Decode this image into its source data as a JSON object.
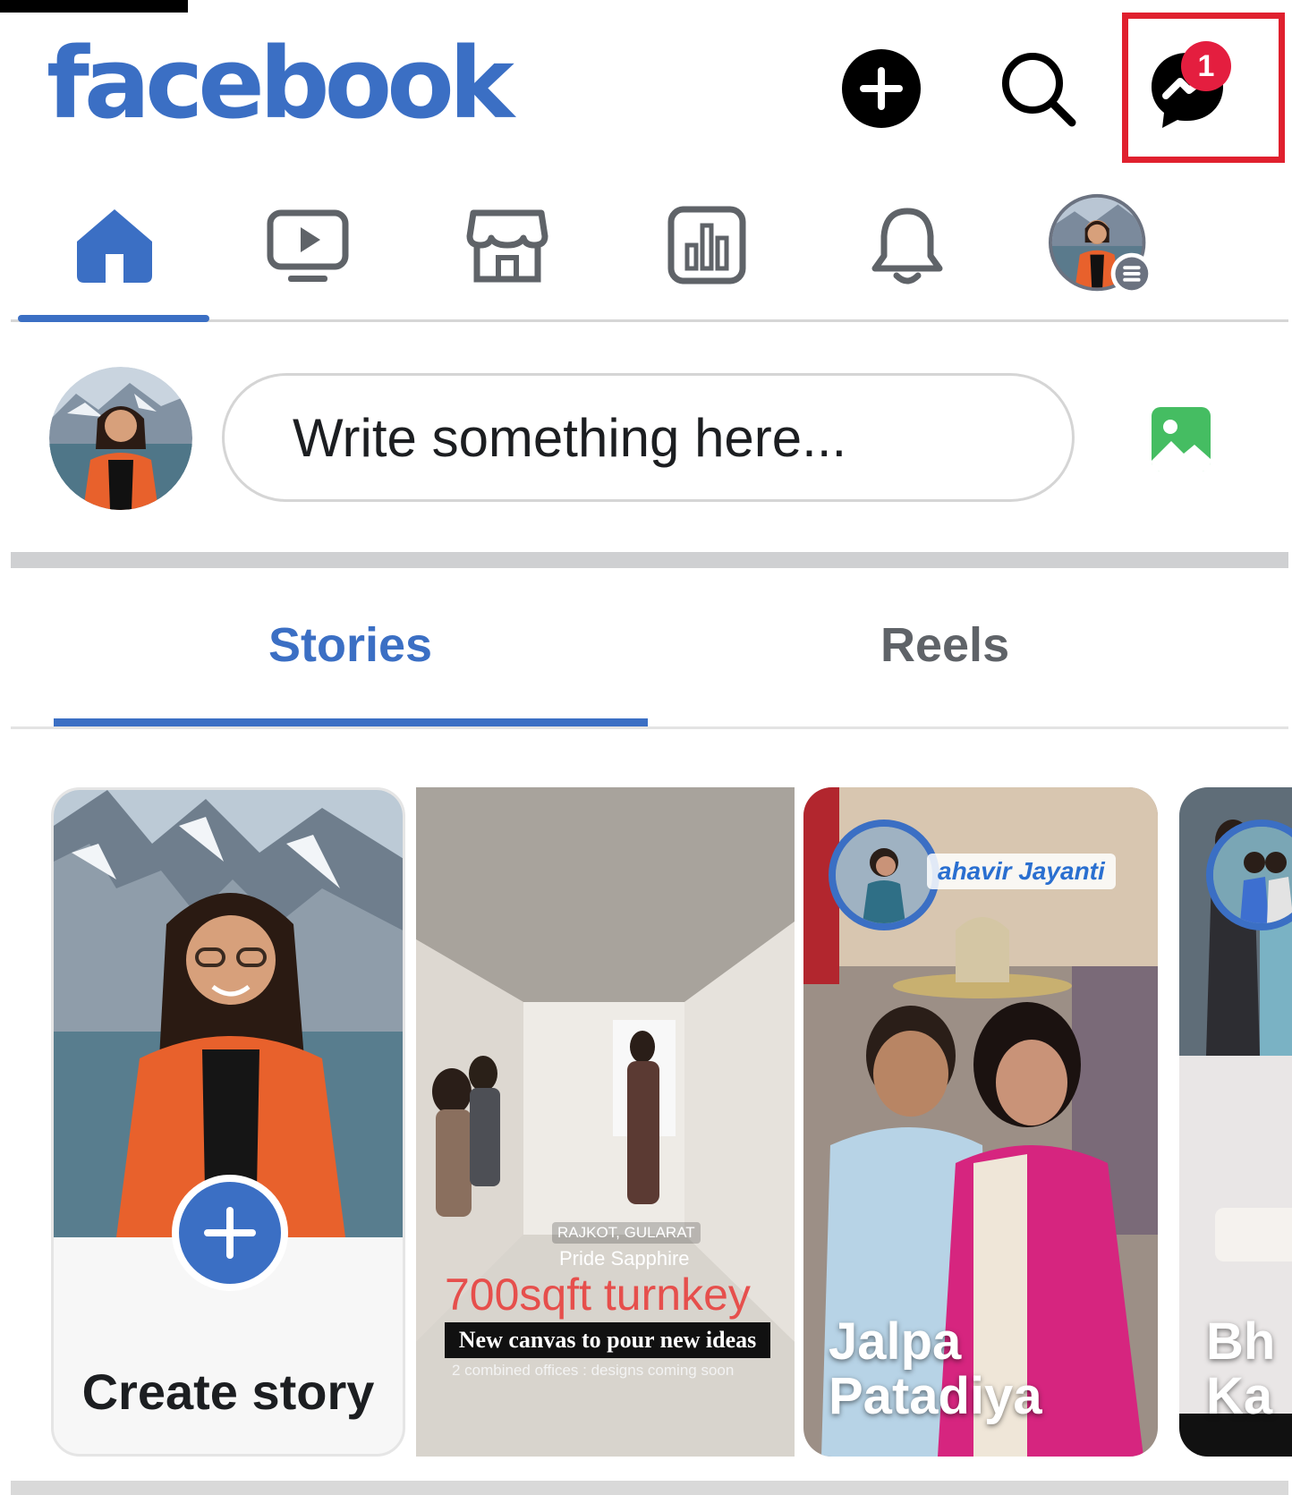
{
  "header": {
    "logo": "facebook",
    "messenger_badge": "1",
    "icons": [
      "add-circle-icon",
      "search-icon",
      "messenger-icon"
    ]
  },
  "nav": {
    "items": [
      {
        "name": "home",
        "icon": "home-icon",
        "active": true
      },
      {
        "name": "video",
        "icon": "video-icon"
      },
      {
        "name": "marketplace",
        "icon": "marketplace-icon"
      },
      {
        "name": "professional-dashboard",
        "icon": "bar-chart-icon"
      },
      {
        "name": "notifications",
        "icon": "bell-icon"
      },
      {
        "name": "profile-menu",
        "icon": "avatar-menu-icon"
      }
    ]
  },
  "composer": {
    "placeholder": "Write something here...",
    "photo_icon": "photo-icon"
  },
  "tabs": {
    "stories": "Stories",
    "reels": "Reels",
    "active": "Stories"
  },
  "stories": {
    "create_label": "Create story",
    "cards": [
      {
        "location": "RAJKOT, GULARAT",
        "subtitle": "Pride Sapphire",
        "headline": "700sqft turnkey",
        "caption": "New canvas to pour new ideas",
        "small_text": "2 combined offices : designs coming soon"
      },
      {
        "event_text": "ahavir Jayanti",
        "name_line1": "Jalpa",
        "name_line2": "Patadiya"
      },
      {
        "name_line1": "Bh",
        "name_line2": "Ka"
      }
    ]
  },
  "colors": {
    "brand_blue": "#3b6fc4",
    "badge_red": "#e41e3f",
    "highlight_red": "#e0202e",
    "photo_green": "#45bd62"
  }
}
